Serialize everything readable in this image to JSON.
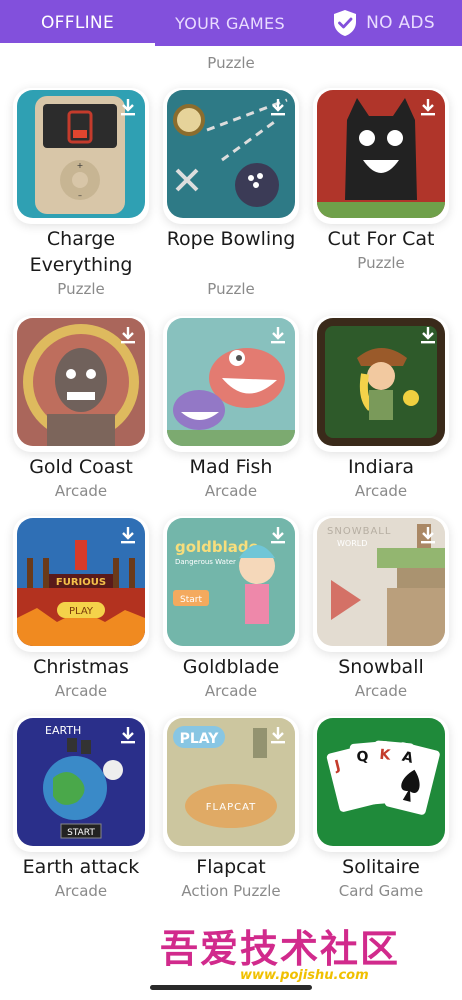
{
  "tabs": {
    "offline": "OFFLINE",
    "your_games": "YOUR GAMES",
    "no_ads": "NO ADS"
  },
  "top_category": "Puzzle",
  "games": [
    {
      "title": "Charge Everything",
      "category": "Puzzle"
    },
    {
      "title": "Rope Bowling",
      "category": "Puzzle"
    },
    {
      "title": "Cut For Cat",
      "category": "Puzzle"
    },
    {
      "title": "Gold Coast",
      "category": "Arcade"
    },
    {
      "title": "Mad Fish",
      "category": "Arcade"
    },
    {
      "title": "Indiara",
      "category": "Arcade"
    },
    {
      "title": "Christmas",
      "category": "Arcade"
    },
    {
      "title": "Goldblade",
      "category": "Arcade"
    },
    {
      "title": "Snowball",
      "category": "Arcade"
    },
    {
      "title": "Earth attack",
      "category": "Arcade"
    },
    {
      "title": "Flapcat",
      "category": "Action Puzzle"
    },
    {
      "title": "Solitaire",
      "category": "Card Game"
    }
  ],
  "thumb_art": {
    "furious": "FURIOUS",
    "play_button": "PLAY",
    "goldblade_logo": "goldblade",
    "goldblade_sub": "Dangerous Water",
    "start_button": "Start",
    "snowball_logo": "SNOWBALL",
    "snowball_sub": "WORLD",
    "earth_logo": "EARTH",
    "earth_start": "START",
    "flapcat_play": "PLAY",
    "flapcat_logo": "FLAPCAT"
  },
  "watermark": {
    "text": "吾爱技术社区",
    "url": "www.pojishu.com"
  },
  "colors": {
    "accent": "#8250dc",
    "title_text": "#1a1a1a",
    "category_text": "#8a8a8a"
  }
}
